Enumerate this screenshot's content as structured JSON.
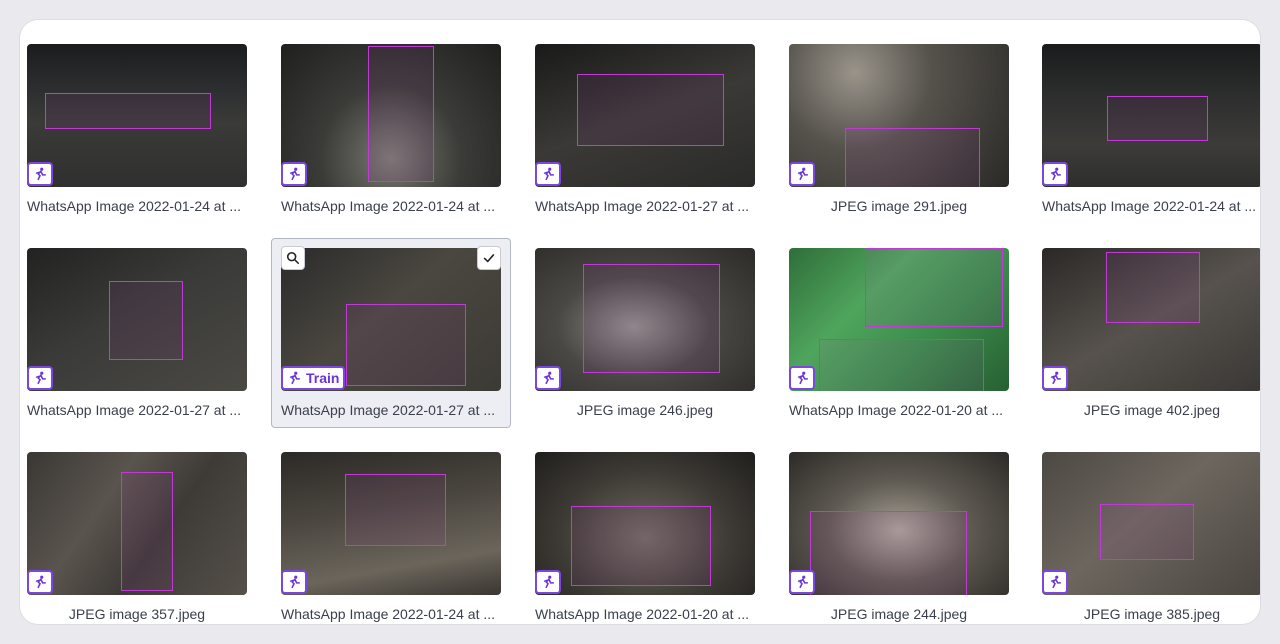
{
  "colors": {
    "accent": "#7b47e0",
    "bbox": "#c23ad6"
  },
  "icons": {
    "tag": "run-icon",
    "zoom": "search-icon",
    "select": "check-icon"
  },
  "selected_tag_label": "Train",
  "images": [
    {
      "name": "WhatsApp Image 2022-01-24 at ...",
      "tag": ""
    },
    {
      "name": "WhatsApp Image 2022-01-24 at ...",
      "tag": ""
    },
    {
      "name": "WhatsApp Image 2022-01-27 at ...",
      "tag": ""
    },
    {
      "name": "JPEG image 291.jpeg",
      "tag": ""
    },
    {
      "name": "WhatsApp Image 2022-01-24 at ...",
      "tag": ""
    },
    {
      "name": "WhatsApp Image 2022-01-27 at ...",
      "tag": ""
    },
    {
      "name": "WhatsApp Image 2022-01-27 at ...",
      "tag": "Train",
      "selected": true
    },
    {
      "name": "JPEG image 246.jpeg",
      "tag": ""
    },
    {
      "name": "WhatsApp Image 2022-01-20 at ...",
      "tag": ""
    },
    {
      "name": "JPEG image 402.jpeg",
      "tag": ""
    },
    {
      "name": "JPEG image 357.jpeg",
      "tag": ""
    },
    {
      "name": "WhatsApp Image 2022-01-24 at ...",
      "tag": ""
    },
    {
      "name": "WhatsApp Image 2022-01-20 at ...",
      "tag": ""
    },
    {
      "name": "JPEG image 244.jpeg",
      "tag": ""
    },
    {
      "name": "JPEG image 385.jpeg",
      "tag": ""
    }
  ]
}
